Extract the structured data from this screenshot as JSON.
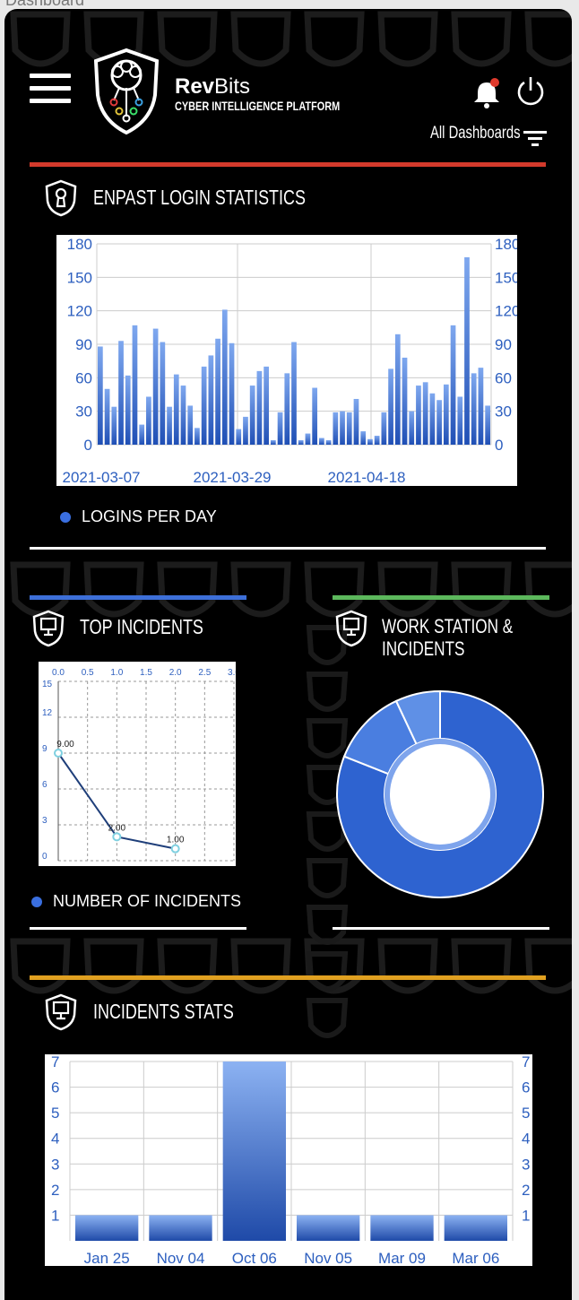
{
  "page": {
    "top_label": "Dashboard"
  },
  "header": {
    "brand_strong": "Rev",
    "brand_light": "Bits",
    "brand_sub": "CYBER INTELLIGENCE PLATFORM",
    "all_dashboards": "All Dashboards",
    "menu_icon": "hamburger-icon",
    "notification_icon": "bell-icon",
    "power_icon": "power-icon",
    "filter_icon": "filter-icon"
  },
  "colors": {
    "red": "#d33a2c",
    "blue": "#3d6fd8",
    "green": "#5cb85c",
    "gold": "#e0a020",
    "bar": "#3a6fd6"
  },
  "sections": {
    "enpast": {
      "title": "ENPAST LOGIN STATISTICS",
      "legend": "LOGINS PER DAY"
    },
    "top_incidents": {
      "title": "TOP INCIDENTS",
      "legend": "NUMBER OF INCIDENTS"
    },
    "workstation": {
      "title_line1": "WORK STATION &",
      "title_line2": "INCIDENTS"
    },
    "incident_stats": {
      "title": "INCIDENTS STATS"
    }
  },
  "chart_data": [
    {
      "type": "bar",
      "name": "enpast",
      "title": "ENPAST LOGIN STATISTICS",
      "x_tick_labels": [
        "2021-03-07",
        "2021-03-29",
        "2021-04-18"
      ],
      "y_ticks": [
        0,
        30,
        60,
        90,
        120,
        150,
        180
      ],
      "ylim": [
        0,
        180
      ],
      "series": [
        {
          "name": "LOGINS PER DAY",
          "values": [
            88,
            50,
            34,
            93,
            62,
            107,
            18,
            43,
            104,
            92,
            34,
            63,
            53,
            35,
            15,
            70,
            80,
            95,
            121,
            91,
            14,
            25,
            53,
            66,
            70,
            4,
            29,
            64,
            92,
            4,
            10,
            51,
            6,
            4,
            29,
            30,
            29,
            41,
            12,
            5,
            8,
            29,
            68,
            99,
            78,
            30,
            53,
            56,
            46,
            40,
            54,
            107,
            43,
            168,
            64,
            69,
            35
          ]
        }
      ]
    },
    {
      "type": "line",
      "name": "top_incidents",
      "x_ticks": [
        "0.0",
        "0.5",
        "1.0",
        "1.5",
        "2.0",
        "2.5",
        "3.0"
      ],
      "y_ticks": [
        0,
        3,
        6,
        9,
        12,
        15
      ],
      "xlim": [
        0,
        3
      ],
      "ylim": [
        0,
        15
      ],
      "series": [
        {
          "name": "NUMBER OF INCIDENTS",
          "points": [
            [
              0,
              9
            ],
            [
              1,
              2
            ],
            [
              2,
              1
            ]
          ],
          "labels": [
            "9.00",
            "2.00",
            "1.00"
          ]
        }
      ]
    },
    {
      "type": "pie",
      "name": "workstation",
      "values": [
        81,
        12,
        7
      ]
    },
    {
      "type": "bar",
      "name": "incident_stats",
      "categories": [
        "Jan 25",
        "Nov 04",
        "Oct 06",
        "Nov 05",
        "Mar 09",
        "Mar 06"
      ],
      "values": [
        1,
        1,
        7,
        1,
        1,
        1
      ],
      "y_ticks": [
        1,
        2,
        3,
        4,
        5,
        6,
        7
      ],
      "ylim": [
        0,
        7
      ]
    }
  ]
}
